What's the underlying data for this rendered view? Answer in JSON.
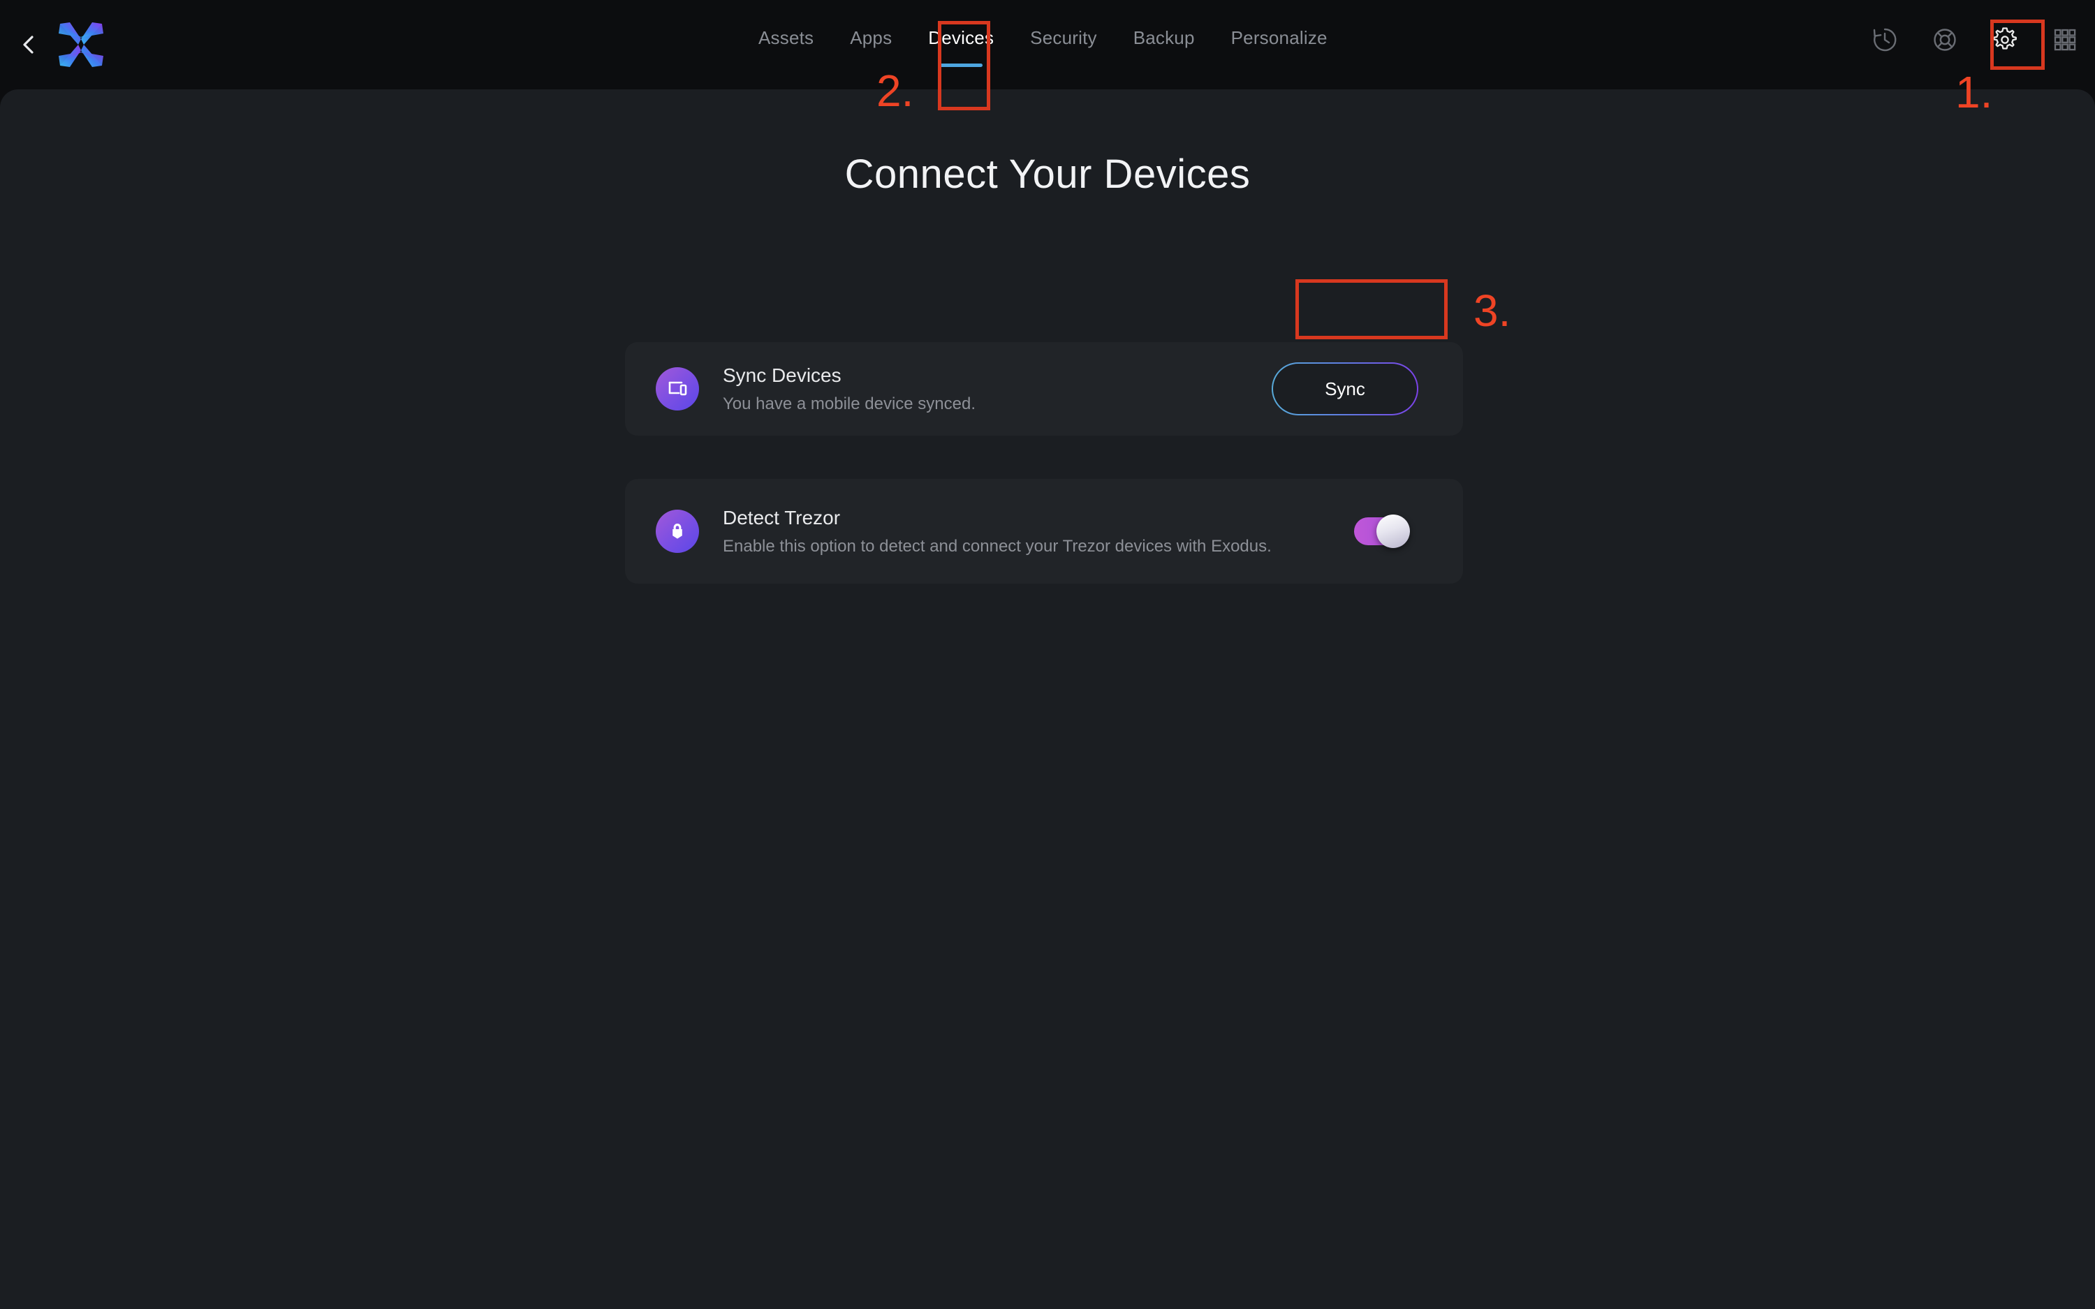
{
  "app": {
    "name": "Exodus",
    "logo_icon": "exodus-x-logo",
    "back_icon": "chevron-left-icon"
  },
  "header": {
    "tabs": [
      {
        "label": "Assets",
        "active": false
      },
      {
        "label": "Apps",
        "active": false
      },
      {
        "label": "Devices",
        "active": true
      },
      {
        "label": "Security",
        "active": false
      },
      {
        "label": "Backup",
        "active": false
      },
      {
        "label": "Personalize",
        "active": false
      }
    ],
    "icons": [
      {
        "name": "history-icon"
      },
      {
        "name": "lifebuoy-help-icon"
      },
      {
        "name": "gear-settings-icon"
      },
      {
        "name": "grid-apps-icon"
      }
    ],
    "active_tab_underline_color": "#4ea6e0"
  },
  "main": {
    "title": "Connect Your Devices",
    "cards": [
      {
        "id": "sync-devices",
        "icon": "monitor-phone-icon",
        "title": "Sync Devices",
        "subtitle": "You have a mobile device synced.",
        "action": {
          "type": "button",
          "label": "Sync"
        }
      },
      {
        "id": "detect-trezor",
        "icon": "trezor-lock-icon",
        "title": "Detect Trezor",
        "subtitle": "Enable this option to detect and connect your Trezor devices with Exodus.",
        "action": {
          "type": "toggle",
          "state": "on"
        }
      }
    ]
  },
  "annotations": [
    {
      "number": "1.",
      "target": "gear-settings-icon"
    },
    {
      "number": "2.",
      "target": "tab-devices"
    },
    {
      "number": "3.",
      "target": "sync-button"
    }
  ],
  "colors": {
    "header_bg": "#0c0d0f",
    "content_bg": "#1b1e22",
    "card_bg": "#212428",
    "accent_blue": "#4ea6e0",
    "accent_purple": "#7b4fe3",
    "annotation_red": "#d8381f",
    "annotation_number": "#ef4425",
    "toggle_on": "#c057d9"
  }
}
